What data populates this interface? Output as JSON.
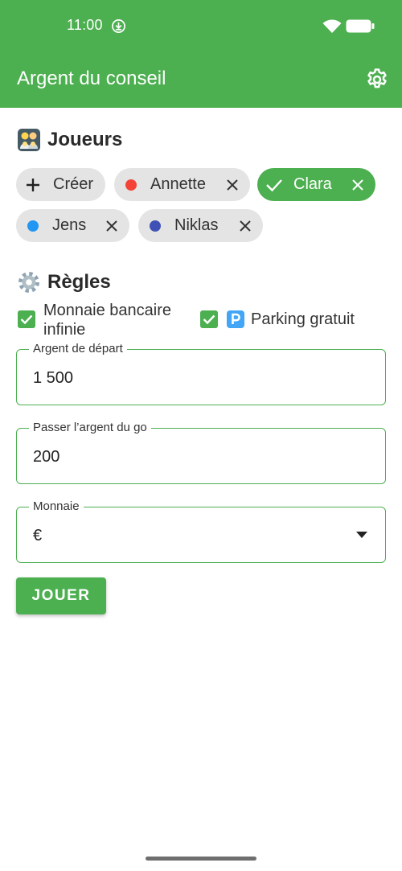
{
  "status_bar": {
    "time": "11:00"
  },
  "app_bar": {
    "title": "Argent du conseil",
    "settings_icon": "gear-icon"
  },
  "players_section": {
    "emoji": "family-emoji",
    "title": "Joueurs",
    "create_chip": {
      "label": "Créer",
      "icon": "plus-icon"
    },
    "players": [
      {
        "name": "Annette",
        "color": "#f44336",
        "selected": false
      },
      {
        "name": "Clara",
        "color": "#4caf50",
        "selected": true
      },
      {
        "name": "Jens",
        "color": "#2196f3",
        "selected": false
      },
      {
        "name": "Niklas",
        "color": "#3f51b5",
        "selected": false
      }
    ]
  },
  "rules_section": {
    "emoji": "gear-emoji",
    "title": "Règles",
    "options": [
      {
        "label_line1": "Monnaie bancaire",
        "label_line2": "infinie",
        "checked": true
      },
      {
        "emoji": "parking-emoji",
        "label": "Parking gratuit",
        "checked": true
      }
    ]
  },
  "fields": {
    "start_money": {
      "label": "Argent de départ",
      "value": "1 500"
    },
    "go_money": {
      "label": "Passer l’argent du go",
      "value": "200"
    },
    "currency": {
      "label": "Monnaie",
      "value": "€"
    }
  },
  "play_button": {
    "label": "JOUER"
  },
  "colors": {
    "accent": "#4caf50",
    "chip_bg": "#e4e4e4"
  }
}
